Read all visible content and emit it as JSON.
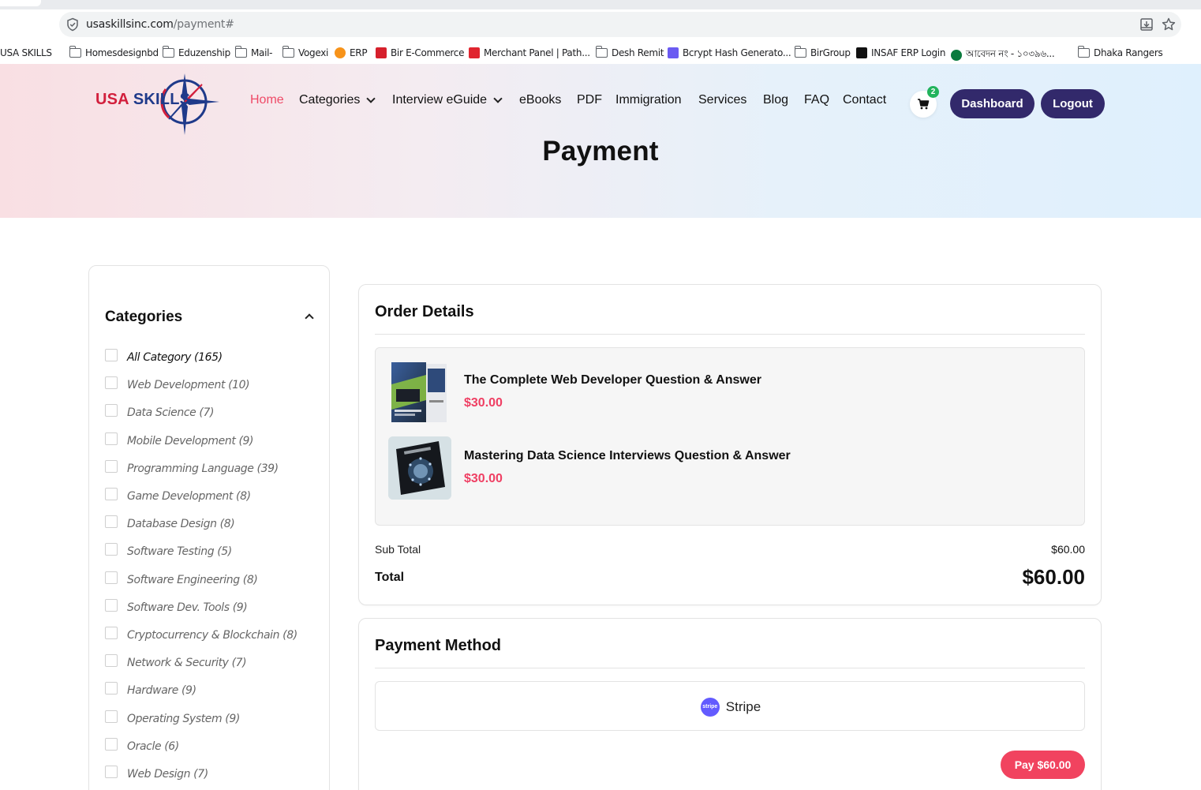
{
  "browser": {
    "url_domain": "usaskillsinc.com",
    "url_path": "/payment#",
    "bookmarks": [
      {
        "label": "USA SKILLS",
        "icon": "none"
      },
      {
        "label": "Homesdesignbd",
        "icon": "folder-icon"
      },
      {
        "label": "Eduzenship",
        "icon": "folder-icon"
      },
      {
        "label": "Mail-",
        "icon": "folder-icon"
      },
      {
        "label": "Vogexi",
        "icon": "folder-icon"
      },
      {
        "label": "ERP",
        "icon": "bitcoin-sun-icon"
      },
      {
        "label": "Bir E-Commerce",
        "icon": "red-logo-icon"
      },
      {
        "label": "Merchant Panel | Path...",
        "icon": "pathao-icon"
      },
      {
        "label": "Desh Remit",
        "icon": "folder-icon"
      },
      {
        "label": "Bcrypt Hash Generato...",
        "icon": "purple-square-icon"
      },
      {
        "label": "BirGroup",
        "icon": "folder-icon"
      },
      {
        "label": "INSAF ERP Login",
        "icon": "black-square-icon"
      },
      {
        "label": "আবেদন নং - ১০৩৯৬...",
        "icon": "bd-seal-icon"
      },
      {
        "label": "Dhaka Rangers",
        "icon": "folder-icon"
      }
    ]
  },
  "header": {
    "logo_usa": "USA",
    "logo_skills": "SKILLS",
    "nav": [
      {
        "label": "Home",
        "active": true,
        "dropdown": false
      },
      {
        "label": "Categories",
        "active": false,
        "dropdown": true
      },
      {
        "label": "Interview eGuide",
        "active": false,
        "dropdown": true
      },
      {
        "label": "eBooks",
        "active": false,
        "dropdown": false
      },
      {
        "label": "PDF",
        "active": false,
        "dropdown": false
      },
      {
        "label": "Immigration",
        "active": false,
        "dropdown": false
      },
      {
        "label": "Services",
        "active": false,
        "dropdown": false
      },
      {
        "label": "Blog",
        "active": false,
        "dropdown": false
      },
      {
        "label": "FAQ",
        "active": false,
        "dropdown": false
      },
      {
        "label": "Contact",
        "active": false,
        "dropdown": false
      }
    ],
    "cart_count": "2",
    "dashboard_label": "Dashboard",
    "logout_label": "Logout",
    "page_title": "Payment"
  },
  "sidebar": {
    "title": "Categories",
    "categories": [
      "All Category (165)",
      "Web Development (10)",
      "Data Science (7)",
      "Mobile Development (9)",
      "Programming Language (39)",
      "Game Development (8)",
      "Database Design (8)",
      "Software Testing (5)",
      "Software Engineering (8)",
      "Software Dev. Tools (9)",
      "Cryptocurrency & Blockchain (8)",
      "Network & Security (7)",
      "Hardware (9)",
      "Operating System (9)",
      "Oracle (6)",
      "Web Design (7)"
    ]
  },
  "order": {
    "title": "Order Details",
    "items": [
      {
        "title": "The Complete Web Developer Question & Answer",
        "price": "$30.00"
      },
      {
        "title": "Mastering Data Science Interviews Question & Answer",
        "price": "$30.00"
      }
    ],
    "subtotal_label": "Sub Total",
    "subtotal_value": "$60.00",
    "total_label": "Total",
    "total_value": "$60.00"
  },
  "payment": {
    "title": "Payment Method",
    "method_label": "Stripe",
    "stripe_logo_text": "stripe",
    "pay_label": "Pay $60.00"
  },
  "colors": {
    "accent_pink": "#ef4a67",
    "brand_navy": "#32296b",
    "badge_green": "#21b35c",
    "stripe_purple": "#635bff"
  }
}
